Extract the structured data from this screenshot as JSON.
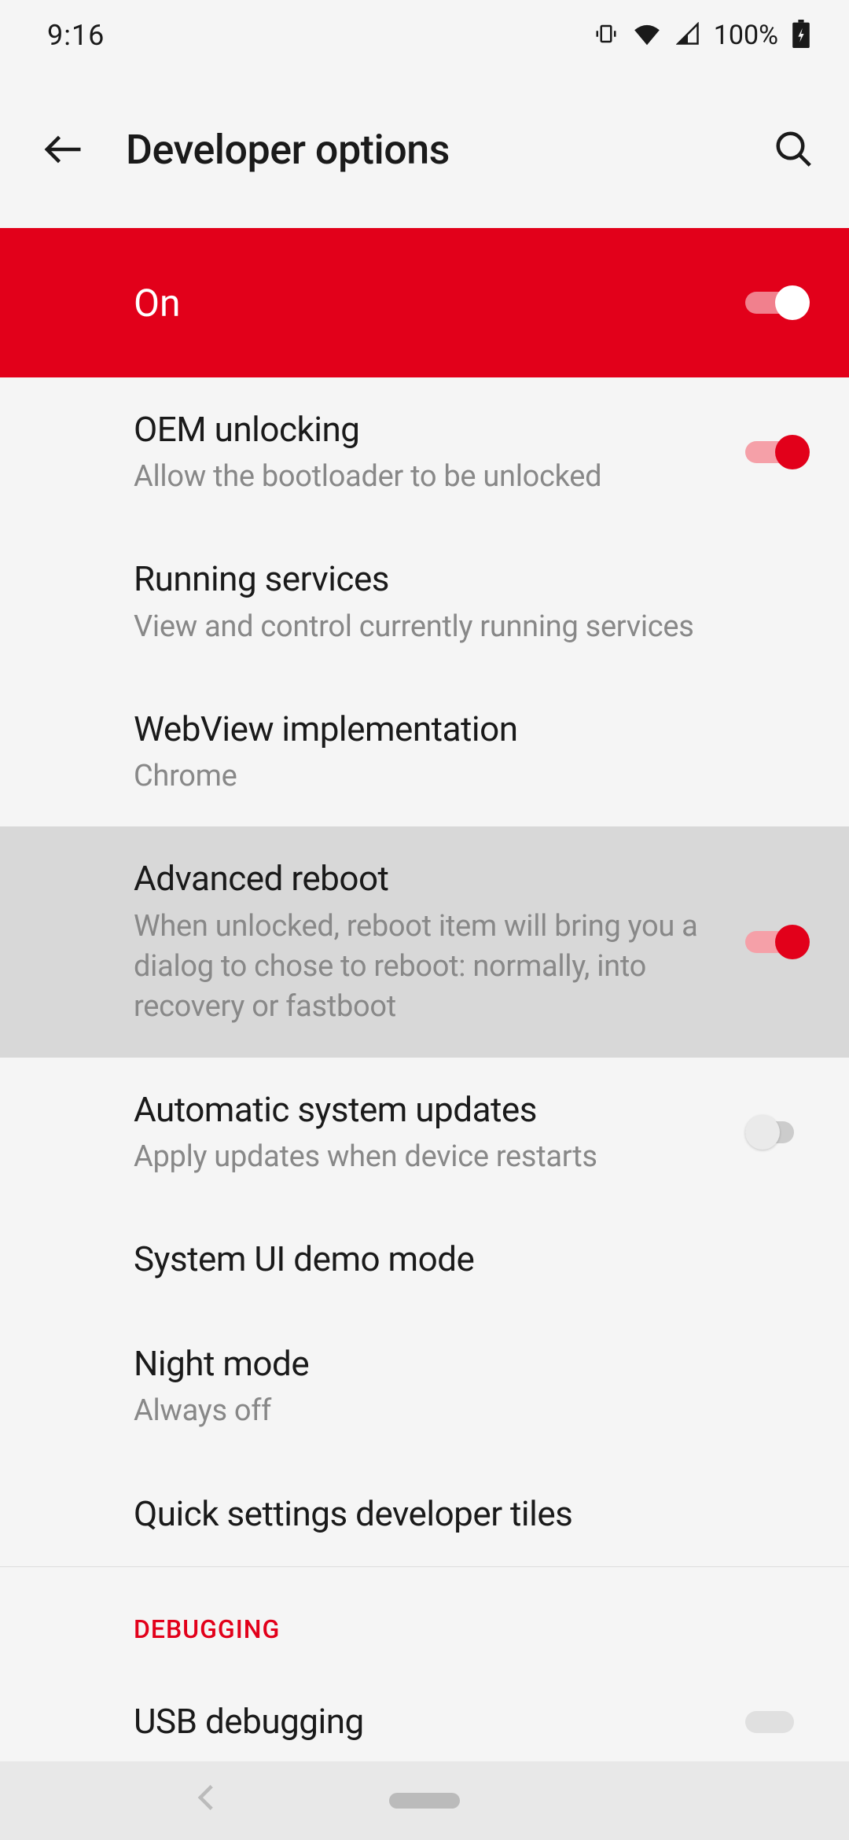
{
  "status": {
    "time": "9:16",
    "battery": "100%"
  },
  "header": {
    "title": "Developer options"
  },
  "master": {
    "label": "On",
    "enabled": true
  },
  "settings": [
    {
      "title": "OEM unlocking",
      "subtitle": "Allow the bootloader to be unlocked",
      "toggle": true,
      "toggle_on": true,
      "highlighted": false
    },
    {
      "title": "Running services",
      "subtitle": "View and control currently running services",
      "toggle": false,
      "highlighted": false
    },
    {
      "title": "WebView implementation",
      "subtitle": "Chrome",
      "toggle": false,
      "highlighted": false
    },
    {
      "title": "Advanced reboot",
      "subtitle": "When unlocked, reboot item will bring you a dialog to chose to reboot: normally, into recovery or fastboot",
      "toggle": true,
      "toggle_on": true,
      "highlighted": true
    },
    {
      "title": "Automatic system updates",
      "subtitle": "Apply updates when device restarts",
      "toggle": true,
      "toggle_on": false,
      "highlighted": false
    },
    {
      "title": "System UI demo mode",
      "subtitle": "",
      "toggle": false,
      "highlighted": false
    },
    {
      "title": "Night mode",
      "subtitle": "Always off",
      "toggle": false,
      "highlighted": false
    },
    {
      "title": "Quick settings developer tiles",
      "subtitle": "",
      "toggle": false,
      "highlighted": false
    }
  ],
  "section": {
    "debugging": "DEBUGGING"
  },
  "usb": {
    "title": "USB debugging"
  }
}
